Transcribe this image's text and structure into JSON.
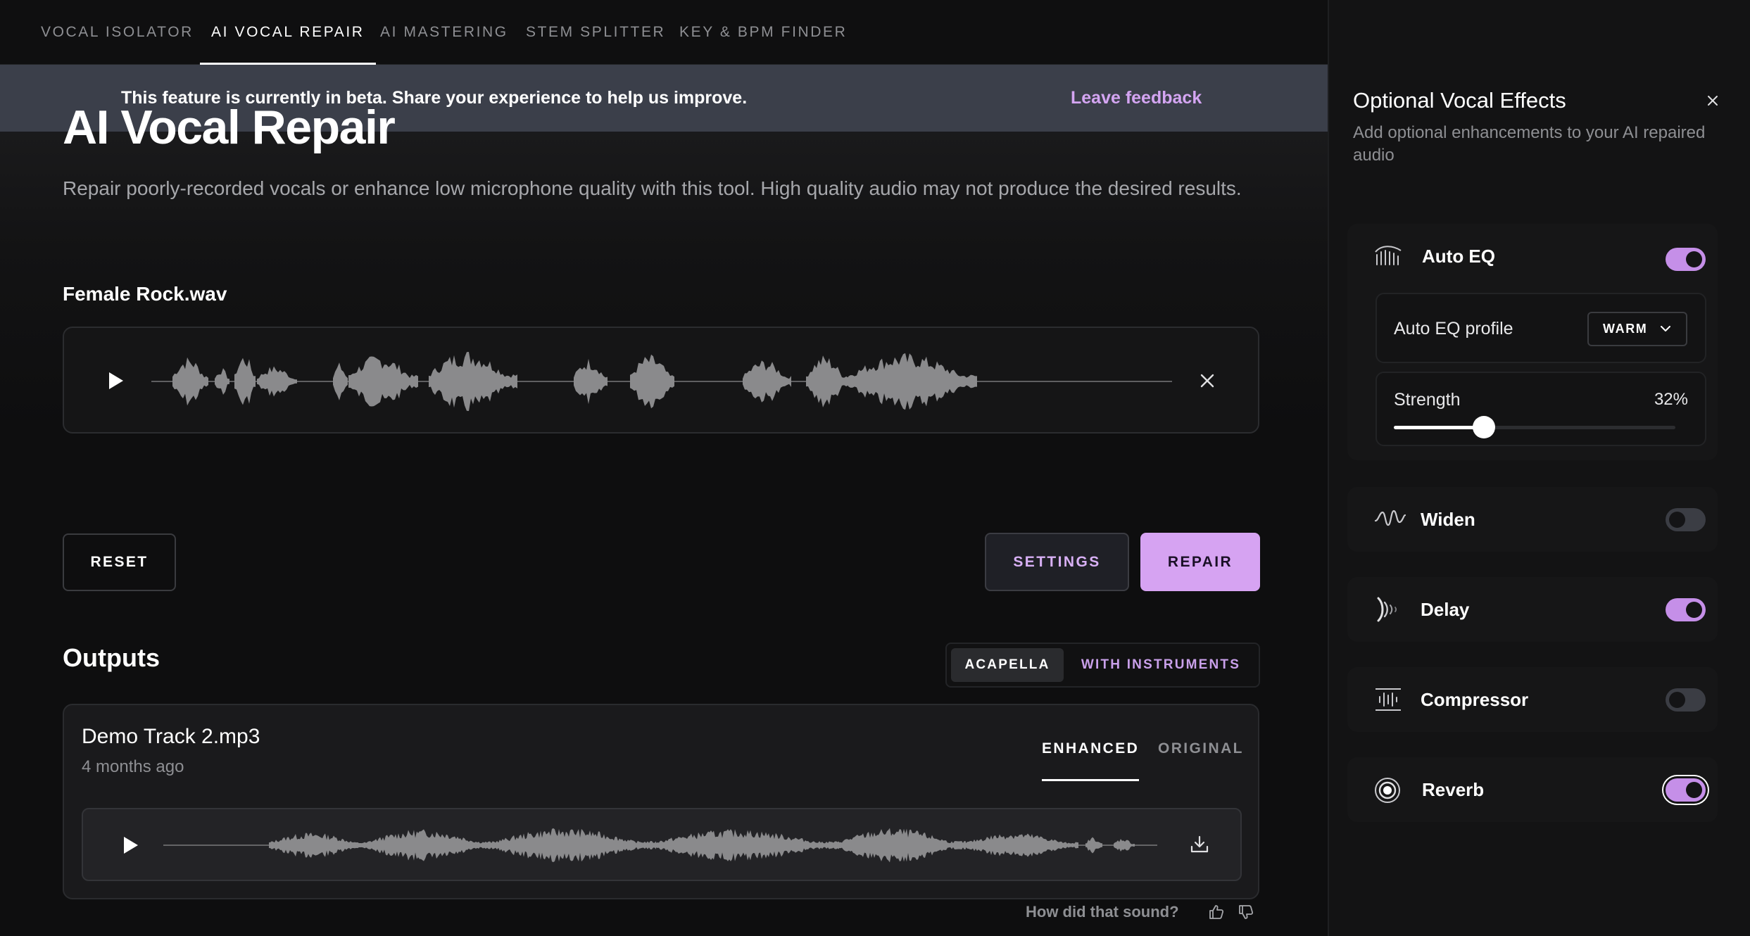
{
  "nav": {
    "tabs": [
      {
        "label": "VOCAL ISOLATOR",
        "active": false
      },
      {
        "label": "AI VOCAL REPAIR",
        "active": true
      },
      {
        "label": "AI MASTERING",
        "active": false
      },
      {
        "label": "STEM SPLITTER",
        "active": false
      },
      {
        "label": "KEY & BPM FINDER",
        "active": false
      }
    ]
  },
  "beta_banner": {
    "message": "This feature is currently in beta. Share your experience to help us improve.",
    "link": "Leave feedback"
  },
  "page": {
    "title": "AI Vocal Repair",
    "description": "Repair poorly-recorded vocals or enhance low microphone quality with this tool. High quality audio may not produce the desired results."
  },
  "input_file": {
    "name": "Female Rock.wav",
    "play_icon": "play-icon",
    "remove_icon": "close-icon"
  },
  "actions": {
    "reset": "RESET",
    "settings": "SETTINGS",
    "repair": "REPAIR"
  },
  "outputs": {
    "heading": "Outputs",
    "segment": {
      "selected": "ACAPELLA",
      "other": "WITH INSTRUMENTS"
    },
    "item": {
      "track_name": "Demo Track 2.mp3",
      "time_ago": "4 months ago",
      "version_tabs": {
        "active": "ENHANCED",
        "inactive": "ORIGINAL"
      },
      "download_icon": "download-icon"
    },
    "feedback_question": "How did that sound?",
    "thumbs_up_icon": "thumbs-up-icon",
    "thumbs_down_icon": "thumbs-down-icon"
  },
  "effects_panel": {
    "title": "Optional Vocal Effects",
    "subtitle": "Add optional enhancements to your AI repaired audio",
    "close_icon": "close-icon",
    "auto_eq": {
      "label": "Auto EQ",
      "enabled": true,
      "profile_label": "Auto EQ profile",
      "profile_value": "WARM",
      "strength_label": "Strength",
      "strength_value": "32%",
      "strength_fraction": 0.32
    },
    "effects": [
      {
        "label": "Widen",
        "icon": "widen-icon",
        "enabled": false
      },
      {
        "label": "Delay",
        "icon": "delay-icon",
        "enabled": true
      },
      {
        "label": "Compressor",
        "icon": "compressor-icon",
        "enabled": false
      },
      {
        "label": "Reverb",
        "icon": "reverb-icon",
        "enabled": true
      }
    ]
  },
  "colors": {
    "accent": "#d6a3f2",
    "toggle_on": "#c58fe8",
    "banner": "#3b3f4a",
    "background": "#0e0e0f"
  }
}
